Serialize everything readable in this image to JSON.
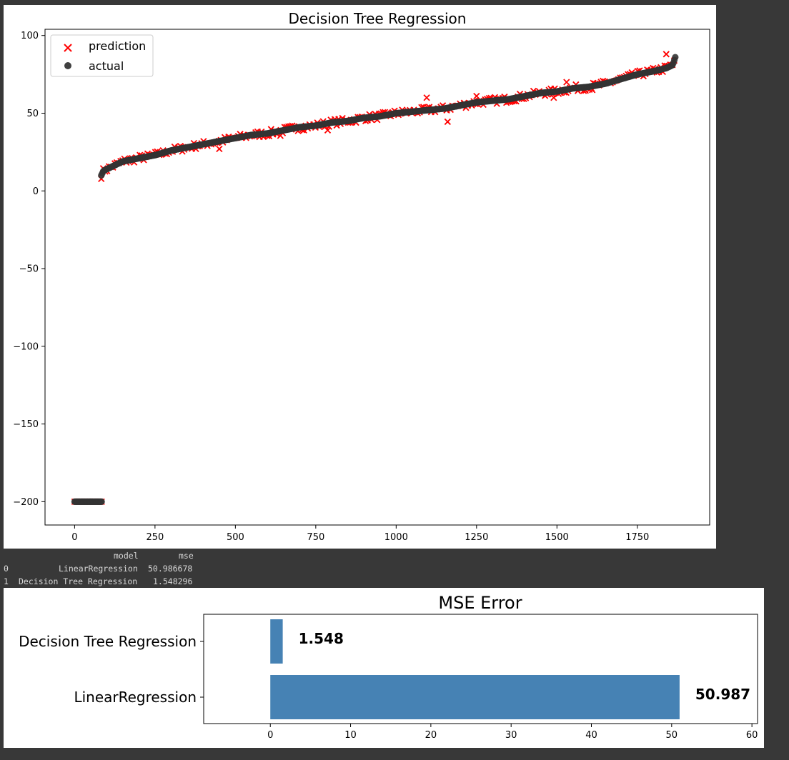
{
  "chart_data": [
    {
      "type": "scatter",
      "title": "Decision Tree Regression",
      "xlabel": "",
      "ylabel": "",
      "xlim": [
        -92,
        1975
      ],
      "ylim": [
        -215,
        104
      ],
      "xticks": [
        0,
        250,
        500,
        750,
        1000,
        1250,
        1500,
        1750
      ],
      "yticks": [
        100,
        50,
        0,
        -50,
        -100,
        -150,
        -200
      ],
      "tick_labels_x": [
        "0",
        "250",
        "500",
        "750",
        "1000",
        "1250",
        "1500",
        "1750"
      ],
      "tick_labels_y": [
        "100",
        "50",
        "0",
        "−50",
        "−100",
        "−150",
        "−200"
      ],
      "legend": {
        "position": "upper-left",
        "entries": [
          {
            "label": "prediction",
            "marker": "x",
            "color": "#ff0000"
          },
          {
            "label": "actual",
            "marker": "o",
            "color": "#404040"
          }
        ]
      },
      "series": [
        {
          "name": "actual",
          "marker": "o",
          "color": "#404040",
          "description_points": [
            [
              0,
              -200
            ],
            [
              85,
              -200
            ],
            [
              83,
              10
            ],
            [
              90,
              13
            ],
            [
              120,
              16
            ],
            [
              150,
              19
            ],
            [
              200,
              21
            ],
            [
              250,
              23
            ],
            [
              300,
              26
            ],
            [
              350,
              28
            ],
            [
              400,
              30
            ],
            [
              450,
              32
            ],
            [
              500,
              34
            ],
            [
              550,
              36
            ],
            [
              600,
              37
            ],
            [
              650,
              39
            ],
            [
              700,
              41
            ],
            [
              750,
              42
            ],
            [
              800,
              44
            ],
            [
              850,
              45
            ],
            [
              900,
              47
            ],
            [
              950,
              48
            ],
            [
              1000,
              50
            ],
            [
              1050,
              51
            ],
            [
              1100,
              52
            ],
            [
              1150,
              53
            ],
            [
              1200,
              55
            ],
            [
              1250,
              57
            ],
            [
              1300,
              58
            ],
            [
              1350,
              59
            ],
            [
              1400,
              61
            ],
            [
              1450,
              63
            ],
            [
              1500,
              64
            ],
            [
              1550,
              66
            ],
            [
              1600,
              67
            ],
            [
              1650,
              69
            ],
            [
              1700,
              72
            ],
            [
              1750,
              75
            ],
            [
              1800,
              77
            ],
            [
              1840,
              79
            ],
            [
              1860,
              81
            ],
            [
              1868,
              86
            ]
          ]
        },
        {
          "name": "prediction",
          "marker": "x",
          "color": "#ff0000",
          "outliers": [
            [
              1095,
              60
            ],
            [
              1160,
              44.5
            ],
            [
              1840,
              88
            ],
            [
              787,
              39
            ],
            [
              450,
              27
            ],
            [
              640,
              35.5
            ],
            [
              1490,
              60
            ],
            [
              1250,
              61
            ],
            [
              1530,
              70
            ],
            [
              1610,
              65
            ]
          ]
        }
      ]
    },
    {
      "type": "bar",
      "orientation": "horizontal",
      "title": "MSE Error",
      "categories": [
        "LinearRegression",
        "Decision Tree Regression"
      ],
      "values": [
        50.987,
        1.548
      ],
      "value_labels": [
        "50.987",
        "1.548"
      ],
      "xlim": [
        -8.3,
        60.7
      ],
      "xticks": [
        0,
        10,
        20,
        30,
        40,
        50,
        60
      ],
      "tick_labels_x": [
        "0",
        "10",
        "20",
        "30",
        "40",
        "50",
        "60"
      ],
      "color": "#4682b4"
    }
  ],
  "table_output": {
    "columns": [
      "model",
      "mse"
    ],
    "rows": [
      {
        "index": "0",
        "model": "LinearRegression",
        "mse": "50.986678"
      },
      {
        "index": "1",
        "model": "Decision Tree Regression",
        "mse": "1.548296"
      }
    ]
  }
}
